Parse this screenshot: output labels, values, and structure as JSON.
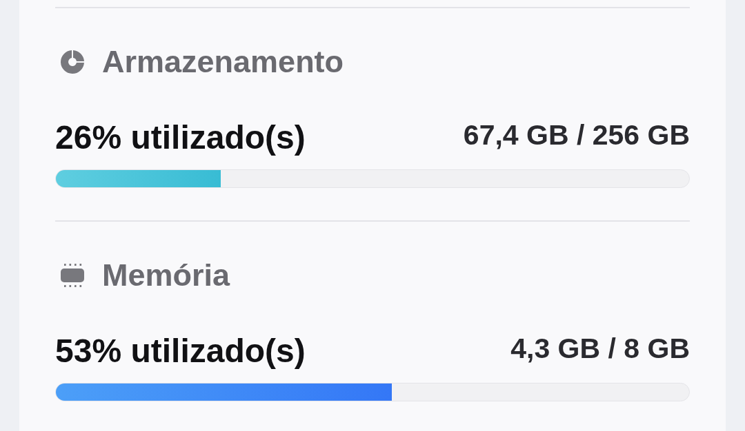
{
  "sections": [
    {
      "kind": "storage",
      "title": "Armazenamento",
      "usage": "26% utilizado(s)",
      "amount": "67,4 GB / 256 GB",
      "level": 0.26
    },
    {
      "kind": "memory",
      "title": "Memória",
      "usage": "53% utilizado(s)",
      "amount": "4,3 GB / 8 GB",
      "level": 0.53
    }
  ]
}
